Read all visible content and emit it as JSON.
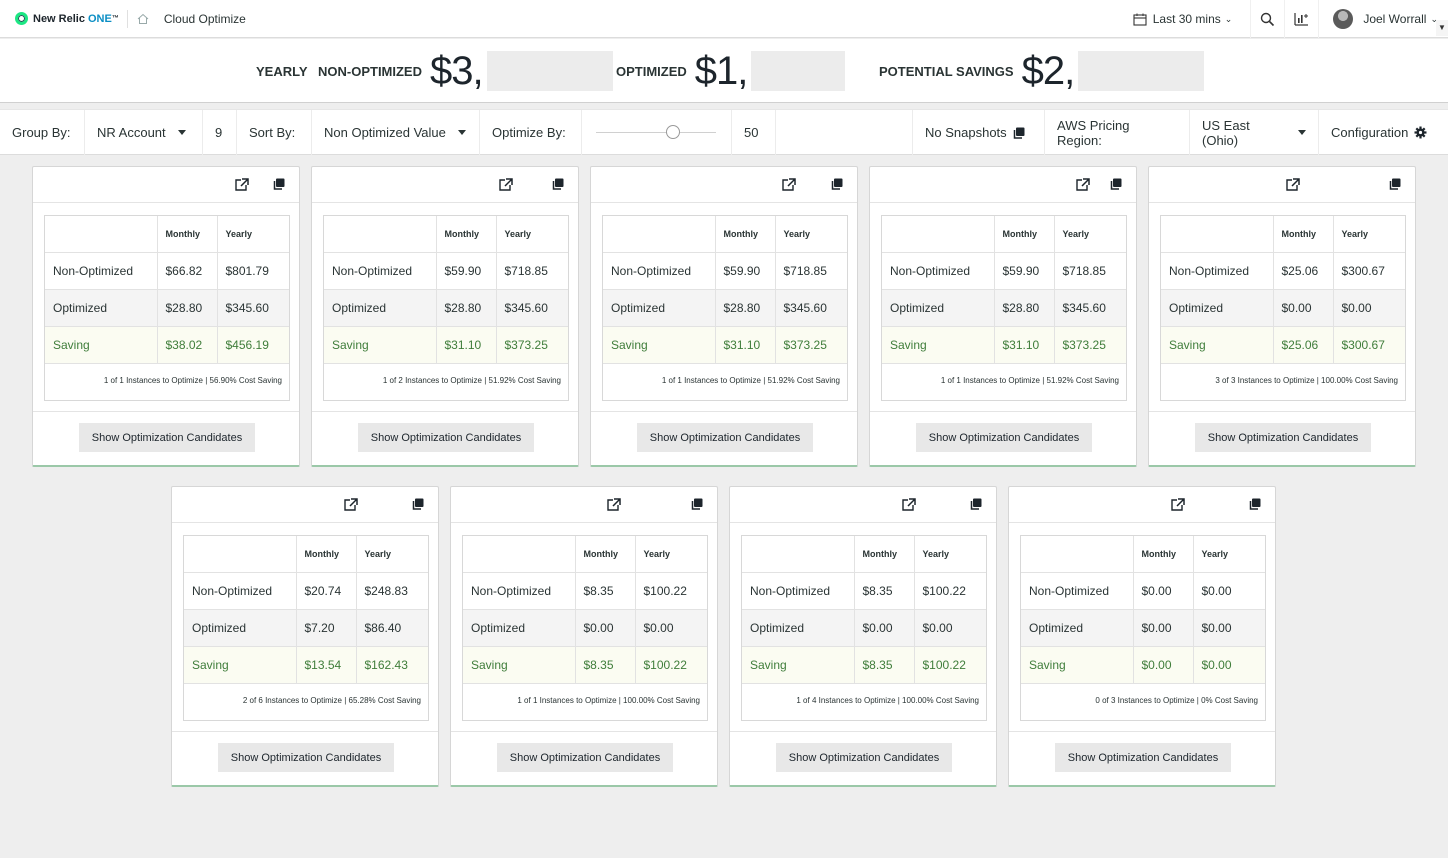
{
  "nav": {
    "brand": "New Relic",
    "brand_one": "ONE",
    "brand_tm": "™",
    "page_title": "Cloud Optimize",
    "time_range": "Last 30 mins",
    "user": "Joel Worrall"
  },
  "summary": {
    "period_label": "YEARLY",
    "non_optimized_label": "NON-OPTIMIZED",
    "non_optimized_value": "$3,",
    "optimized_label": "OPTIMIZED",
    "optimized_value": "$1,",
    "savings_label": "POTENTIAL SAVINGS",
    "savings_value": "$2,"
  },
  "toolbar": {
    "group_by_label": "Group By:",
    "group_by_value": "NR Account",
    "group_count": "9",
    "sort_by_label": "Sort By:",
    "sort_by_value": "Non Optimized Value",
    "optimize_by_label": "Optimize By:",
    "optimize_by_percent": 50,
    "optimize_by_value": "50",
    "snapshots_label": "No Snapshots",
    "pricing_region_label": "AWS Pricing Region:",
    "pricing_region_value": "US East (Ohio)",
    "configuration_label": "Configuration"
  },
  "table_headers": {
    "monthly": "Monthly",
    "yearly": "Yearly"
  },
  "row_labels": {
    "non_optimized": "Non-Optimized",
    "optimized": "Optimized",
    "saving": "Saving"
  },
  "button_label": "Show Optimization Candidates",
  "colors": {
    "saving_text": "#3f7d3a",
    "card_accent": "#9bc8a8"
  },
  "cards": [
    {
      "non_opt_monthly": "$66.82",
      "non_opt_yearly": "$801.79",
      "opt_monthly": "$28.80",
      "opt_yearly": "$345.60",
      "save_monthly": "$38.02",
      "save_yearly": "$456.19",
      "footer": "1 of 1 Instances to Optimize | 56.90% Cost Saving"
    },
    {
      "non_opt_monthly": "$59.90",
      "non_opt_yearly": "$718.85",
      "opt_monthly": "$28.80",
      "opt_yearly": "$345.60",
      "save_monthly": "$31.10",
      "save_yearly": "$373.25",
      "footer": "1 of 2 Instances to Optimize | 51.92% Cost Saving"
    },
    {
      "non_opt_monthly": "$59.90",
      "non_opt_yearly": "$718.85",
      "opt_monthly": "$28.80",
      "opt_yearly": "$345.60",
      "save_monthly": "$31.10",
      "save_yearly": "$373.25",
      "footer": "1 of 1 Instances to Optimize | 51.92% Cost Saving"
    },
    {
      "non_opt_monthly": "$59.90",
      "non_opt_yearly": "$718.85",
      "opt_monthly": "$28.80",
      "opt_yearly": "$345.60",
      "save_monthly": "$31.10",
      "save_yearly": "$373.25",
      "footer": "1 of 1 Instances to Optimize | 51.92% Cost Saving"
    },
    {
      "non_opt_monthly": "$25.06",
      "non_opt_yearly": "$300.67",
      "opt_monthly": "$0.00",
      "opt_yearly": "$0.00",
      "save_monthly": "$25.06",
      "save_yearly": "$300.67",
      "footer": "3 of 3 Instances to Optimize | 100.00% Cost Saving"
    },
    {
      "non_opt_monthly": "$20.74",
      "non_opt_yearly": "$248.83",
      "opt_monthly": "$7.20",
      "opt_yearly": "$86.40",
      "save_monthly": "$13.54",
      "save_yearly": "$162.43",
      "footer": "2 of 6 Instances to Optimize | 65.28% Cost Saving"
    },
    {
      "non_opt_monthly": "$8.35",
      "non_opt_yearly": "$100.22",
      "opt_monthly": "$0.00",
      "opt_yearly": "$0.00",
      "save_monthly": "$8.35",
      "save_yearly": "$100.22",
      "footer": "1 of 1 Instances to Optimize | 100.00% Cost Saving"
    },
    {
      "non_opt_monthly": "$8.35",
      "non_opt_yearly": "$100.22",
      "opt_monthly": "$0.00",
      "opt_yearly": "$0.00",
      "save_monthly": "$8.35",
      "save_yearly": "$100.22",
      "footer": "1 of 4 Instances to Optimize | 100.00% Cost Saving"
    },
    {
      "non_opt_monthly": "$0.00",
      "non_opt_yearly": "$0.00",
      "opt_monthly": "$0.00",
      "opt_yearly": "$0.00",
      "save_monthly": "$0.00",
      "save_yearly": "$0.00",
      "footer": "0 of 3 Instances to Optimize | 0% Cost Saving"
    }
  ]
}
